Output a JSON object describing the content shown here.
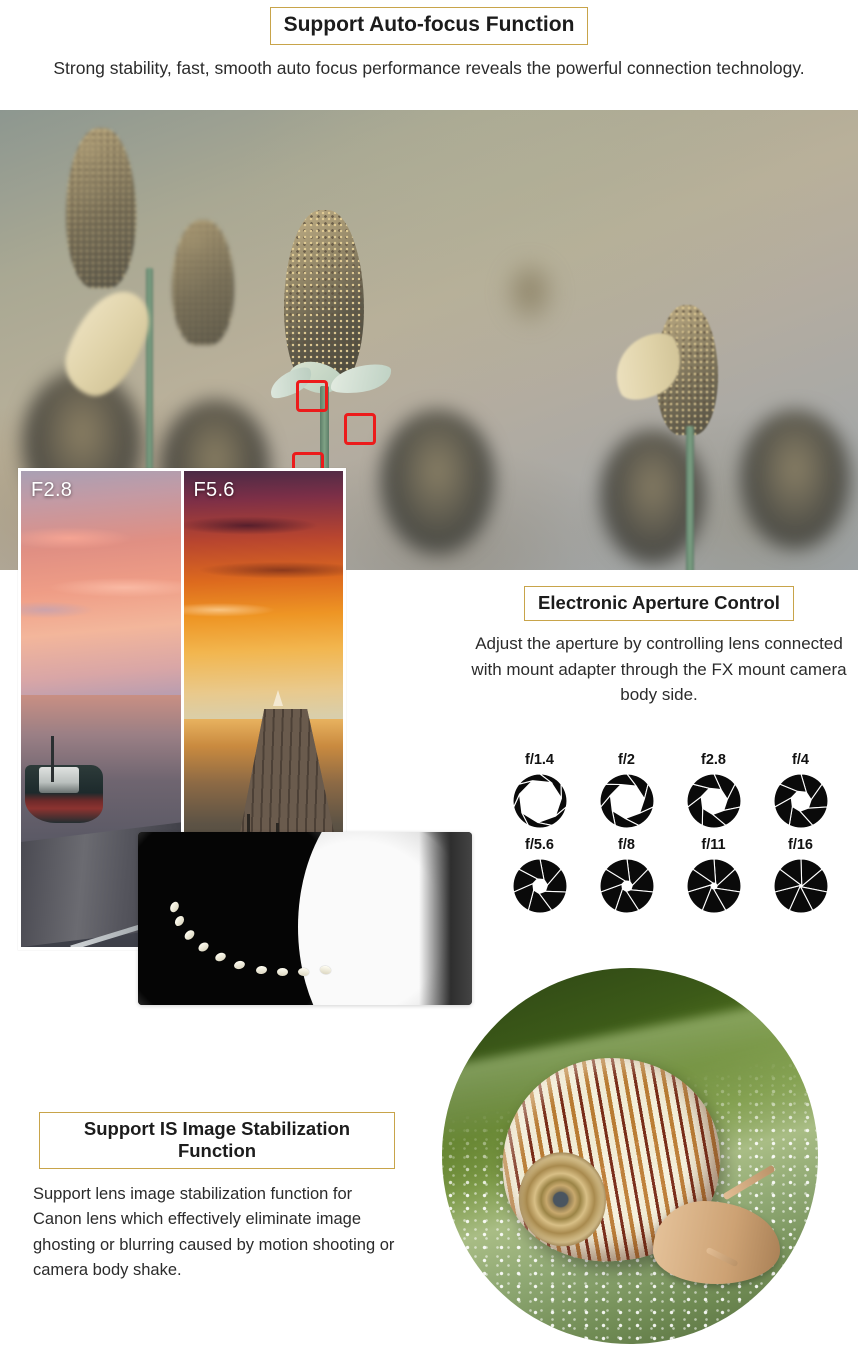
{
  "header": {
    "title": "Support Auto-focus Function",
    "subtitle": "Strong stability, fast, smooth auto focus performance reveals the powerful connection technology."
  },
  "hero": {
    "name": "auto-focus-flower-photo",
    "af_points": 3
  },
  "comparison": {
    "left_label": "F2.8",
    "right_label": "F5.6"
  },
  "aperture_section": {
    "title": "Electronic Aperture Control",
    "body": "Adjust the aperture by controlling lens connected with mount adapter through the FX mount camera body side."
  },
  "aperture_chart": {
    "stops": [
      {
        "label": "f/1.4",
        "openness": 0.8
      },
      {
        "label": "f/2",
        "openness": 0.65
      },
      {
        "label": "f2.8",
        "openness": 0.5
      },
      {
        "label": "f/4",
        "openness": 0.38
      },
      {
        "label": "f/5.6",
        "openness": 0.28
      },
      {
        "label": "f/8",
        "openness": 0.2
      },
      {
        "label": "f/11",
        "openness": 0.12
      },
      {
        "label": "f/16",
        "openness": 0.05
      }
    ]
  },
  "stabilization_section": {
    "title": "Support IS Image Stabilization Function",
    "body": "Support lens image stabilization function for Canon lens which effectively eliminate image ghosting or blurring caused by motion shooting or camera body shake."
  },
  "colors": {
    "title_border": "#c8a44a",
    "af_box": "#ec1b1b",
    "text": "#2b2b2b",
    "heading": "#1c1c1c"
  }
}
